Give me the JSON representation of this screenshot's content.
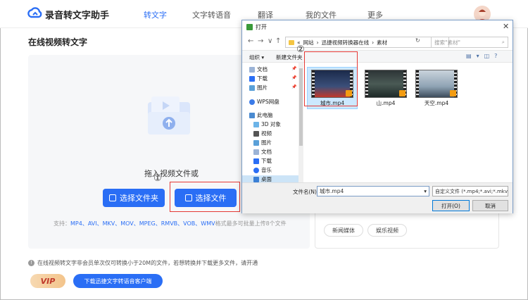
{
  "app": {
    "title": "录音转文字助手",
    "nav": [
      {
        "label": "转文字",
        "active": true
      },
      {
        "label": "文字转语音",
        "active": false
      },
      {
        "label": "翻译",
        "active": false
      },
      {
        "label": "我的文件",
        "active": false
      },
      {
        "label": "更多",
        "active": false
      }
    ],
    "accent_color": "#2a6ef5"
  },
  "page": {
    "title": "在线视频转文字",
    "drop_hint": "拖入视频文件或",
    "select_folder_label": "选择文件夹",
    "select_file_label": "选择文件",
    "support_prefix": "支持：",
    "support_formats": "MP4、AVI、MKV、MOV、MPEG、RMVB、VOB、WMV",
    "support_suffix": "格式最多可批量上传8个文件",
    "annotation_1": "①",
    "annotation_2": "②"
  },
  "right_panel": {
    "tags": [
      "新闻媒体",
      "娱乐视频"
    ]
  },
  "footer": {
    "notice": "在线视频转文字非会员单次仅可转换小于20M的文件，若想转换并下载更多文件，请开通",
    "vip_label": "VIP",
    "download_label": "下载迅捷文字转语音客户端"
  },
  "dialog": {
    "title": "打开",
    "close": "✕",
    "breadcrumb": [
      "«",
      "网站",
      "›",
      "迅捷视频转换器在线",
      "›",
      "素材"
    ],
    "search_placeholder": "搜索\"素材\"",
    "toolbar": {
      "organize": "组织 ▾",
      "new_folder": "新建文件夹"
    },
    "tree": [
      {
        "label": "文档",
        "icon": "document-icon",
        "pinned": true
      },
      {
        "label": "下载",
        "icon": "download-icon",
        "pinned": true
      },
      {
        "label": "图片",
        "icon": "picture-icon",
        "pinned": true
      },
      {
        "label": "WPS网盘",
        "icon": "cloud-icon",
        "pinned": false
      },
      {
        "label": "此电脑",
        "icon": "computer-icon",
        "pinned": false
      },
      {
        "label": "3D 对象",
        "icon": "cube-icon",
        "pinned": false
      },
      {
        "label": "视频",
        "icon": "video-icon",
        "pinned": false
      },
      {
        "label": "图片",
        "icon": "picture-icon",
        "pinned": false
      },
      {
        "label": "文档",
        "icon": "document-icon",
        "pinned": false
      },
      {
        "label": "下载",
        "icon": "download-icon",
        "pinned": false
      },
      {
        "label": "音乐",
        "icon": "music-icon",
        "pinned": false
      },
      {
        "label": "桌面",
        "icon": "desktop-icon",
        "pinned": false
      }
    ],
    "files": [
      {
        "name": "城市.mp4",
        "selected": true
      },
      {
        "name": "山.mp4",
        "selected": false
      },
      {
        "name": "天空.mp4",
        "selected": false
      }
    ],
    "filename_label": "文件名(N):",
    "filename_value": "城市.mp4",
    "filetype_value": "自定义文件 (*.mp4;*.avi;*.mkv",
    "open_label": "打开(O)",
    "cancel_label": "取消"
  }
}
